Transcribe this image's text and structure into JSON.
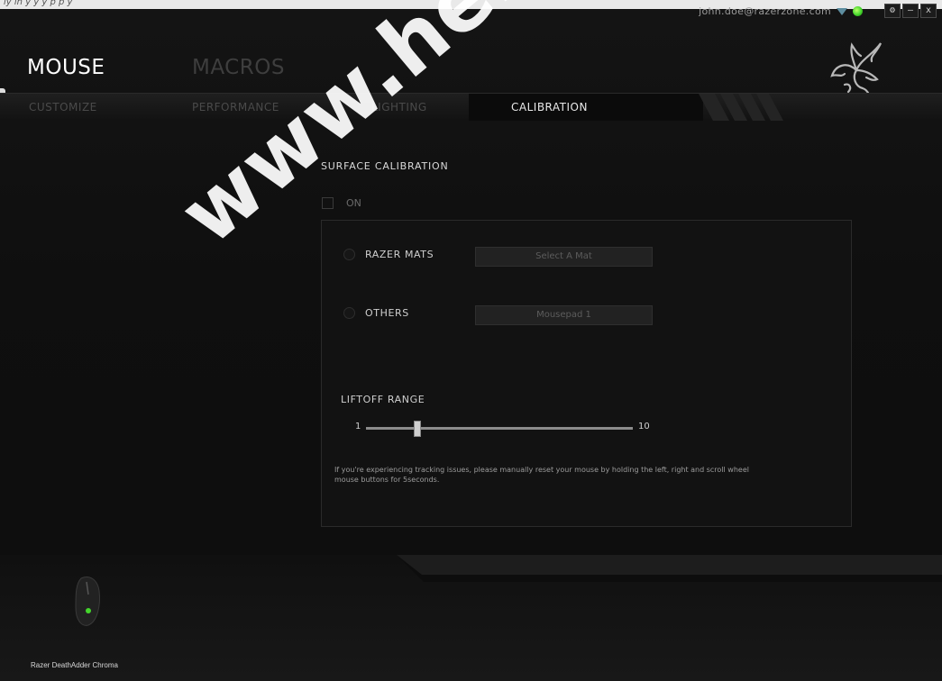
{
  "top_caption": "ly in  y                                                         y y       p                    p  y",
  "account": {
    "email": "john.doe@razerzone.com"
  },
  "window_controls": {
    "settings": "⚙",
    "minimize": "–",
    "close": "x"
  },
  "main_tabs": [
    {
      "label": "MOUSE",
      "active": true
    },
    {
      "label": "MACROS",
      "active": false
    }
  ],
  "sub_tabs": [
    {
      "label": "CUSTOMIZE"
    },
    {
      "label": "PERFORMANCE"
    },
    {
      "label": "LIGHTING"
    },
    {
      "label": "CALIBRATION",
      "active": true
    }
  ],
  "calibration": {
    "section_title": "SURFACE CALIBRATION",
    "toggle_label": "ON",
    "toggle_checked": false,
    "options": [
      {
        "label": "RAZER MATS",
        "dropdown": "Select A Mat"
      },
      {
        "label": "OTHERS",
        "dropdown": "Mousepad 1"
      }
    ],
    "liftoff": {
      "label": "LIFTOFF RANGE",
      "min": "1",
      "max": "10",
      "value": 3
    },
    "info_text": "If you're experiencing tracking issues, please manually reset your mouse by holding the left, right and scroll wheel mouse buttons for 5seconds."
  },
  "device": {
    "name": "Razer DeathAdder Chroma"
  },
  "watermark": "www.hern",
  "colors": {
    "accent": "#44d62c",
    "background": "#0b0b0b"
  }
}
